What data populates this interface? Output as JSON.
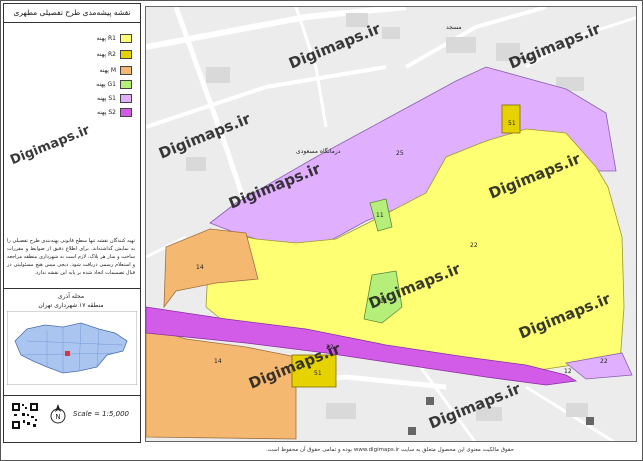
{
  "legend": {
    "title": "نقشه پیشه‌مدی طرح تفصیلی مطهری",
    "items": [
      {
        "code": "R1",
        "label": "پهنه R1",
        "color": "#ffff73"
      },
      {
        "code": "R2",
        "label": "پهنه R2",
        "color": "#e6d200"
      },
      {
        "code": "M",
        "label": "پهنه M",
        "color": "#f5b871"
      },
      {
        "code": "G1",
        "label": "پهنه G1",
        "color": "#b5ef7a"
      },
      {
        "code": "S1",
        "label": "پهنه S1",
        "color": "#e0b0ff"
      },
      {
        "code": "S2",
        "label": "پهنه S2",
        "color": "#d25ce8"
      }
    ],
    "notes": "تهیه کنندگان نقشه تنها سطح قانونی پهنه‌بندی طرح تفصیلی را به نمایش گذاشته‌اند. برای اطلاع دقیق از ضوابط و مقررات ساخت و ساز هر پلاک، لازم است به شهرداری منطقه مراجعه و استعلام رسمی دریافت شود. دیجی مپس هیچ مسئولیتی در قبال تصمیمات اتخاذ شده بر پایه این نقشه ندارد."
  },
  "location": {
    "title": "محله آذری",
    "subtitle": "منطقه ۱۷ شهرداری تهران"
  },
  "scale": {
    "text": "Scale = 1:5,000"
  },
  "footer": "حقوق مالکیت معنوی این محصول متعلق به سایت www.digimaps.ir بوده و تمامی حقوق آن محفوظ است.",
  "map": {
    "zone_labels": [
      "51",
      "25",
      "11",
      "22",
      "14",
      "11",
      "22",
      "14",
      "51",
      "22",
      "12",
      "22"
    ],
    "place_labels": [
      "درمانگاه مسعودی",
      "مدرسه",
      "مسجد"
    ]
  },
  "watermark": "Digimaps.ir"
}
